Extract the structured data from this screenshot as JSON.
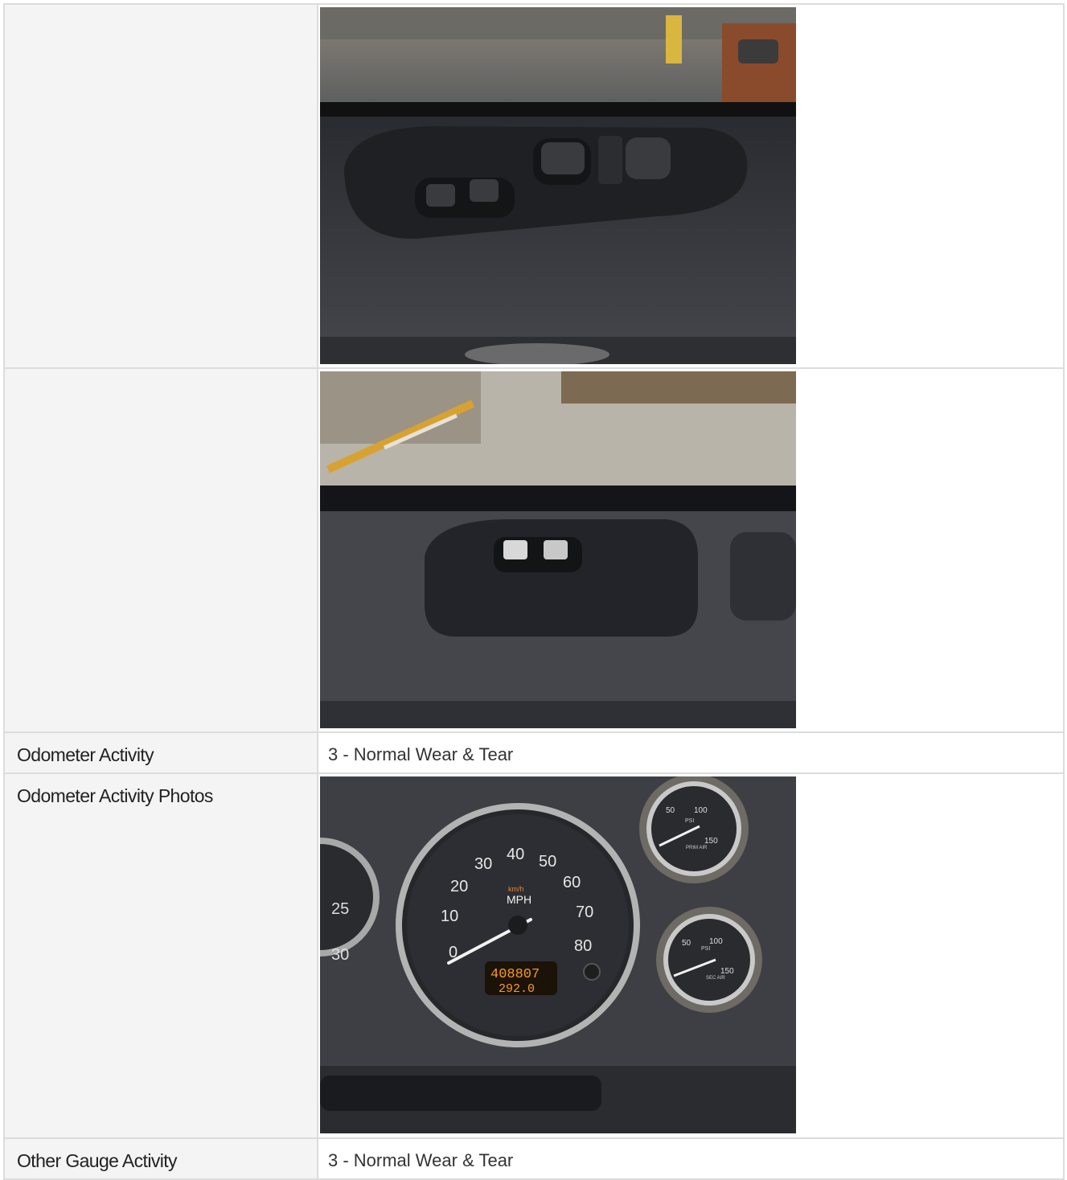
{
  "rows": [
    {
      "label": "",
      "type": "photo",
      "photo": "driver-door-window-switch-photo"
    },
    {
      "label": "",
      "type": "photo",
      "photo": "passenger-door-window-switch-photo"
    },
    {
      "label": "Odometer Activity",
      "value": "3 - Normal Wear & Tear"
    },
    {
      "label": "Odometer Activity Photos",
      "type": "photo",
      "photo": "instrument-cluster-photo"
    },
    {
      "label": "Other Gauge Activity",
      "value": "3 - Normal Wear & Tear"
    }
  ],
  "odometer": {
    "miles": "408807",
    "trip": "292.0"
  },
  "speedo": {
    "unit": "MPH",
    "unit2": "km/h",
    "ticks": [
      "0",
      "10",
      "20",
      "30",
      "40",
      "50",
      "60",
      "70",
      "80"
    ],
    "left_gauge_ticks": [
      "25",
      "30"
    ]
  },
  "gauges": {
    "psi": "PSI",
    "label1": "PRIM AIR",
    "label2": "SEC AIR",
    "n50": "50",
    "n100": "100",
    "n150": "150"
  }
}
